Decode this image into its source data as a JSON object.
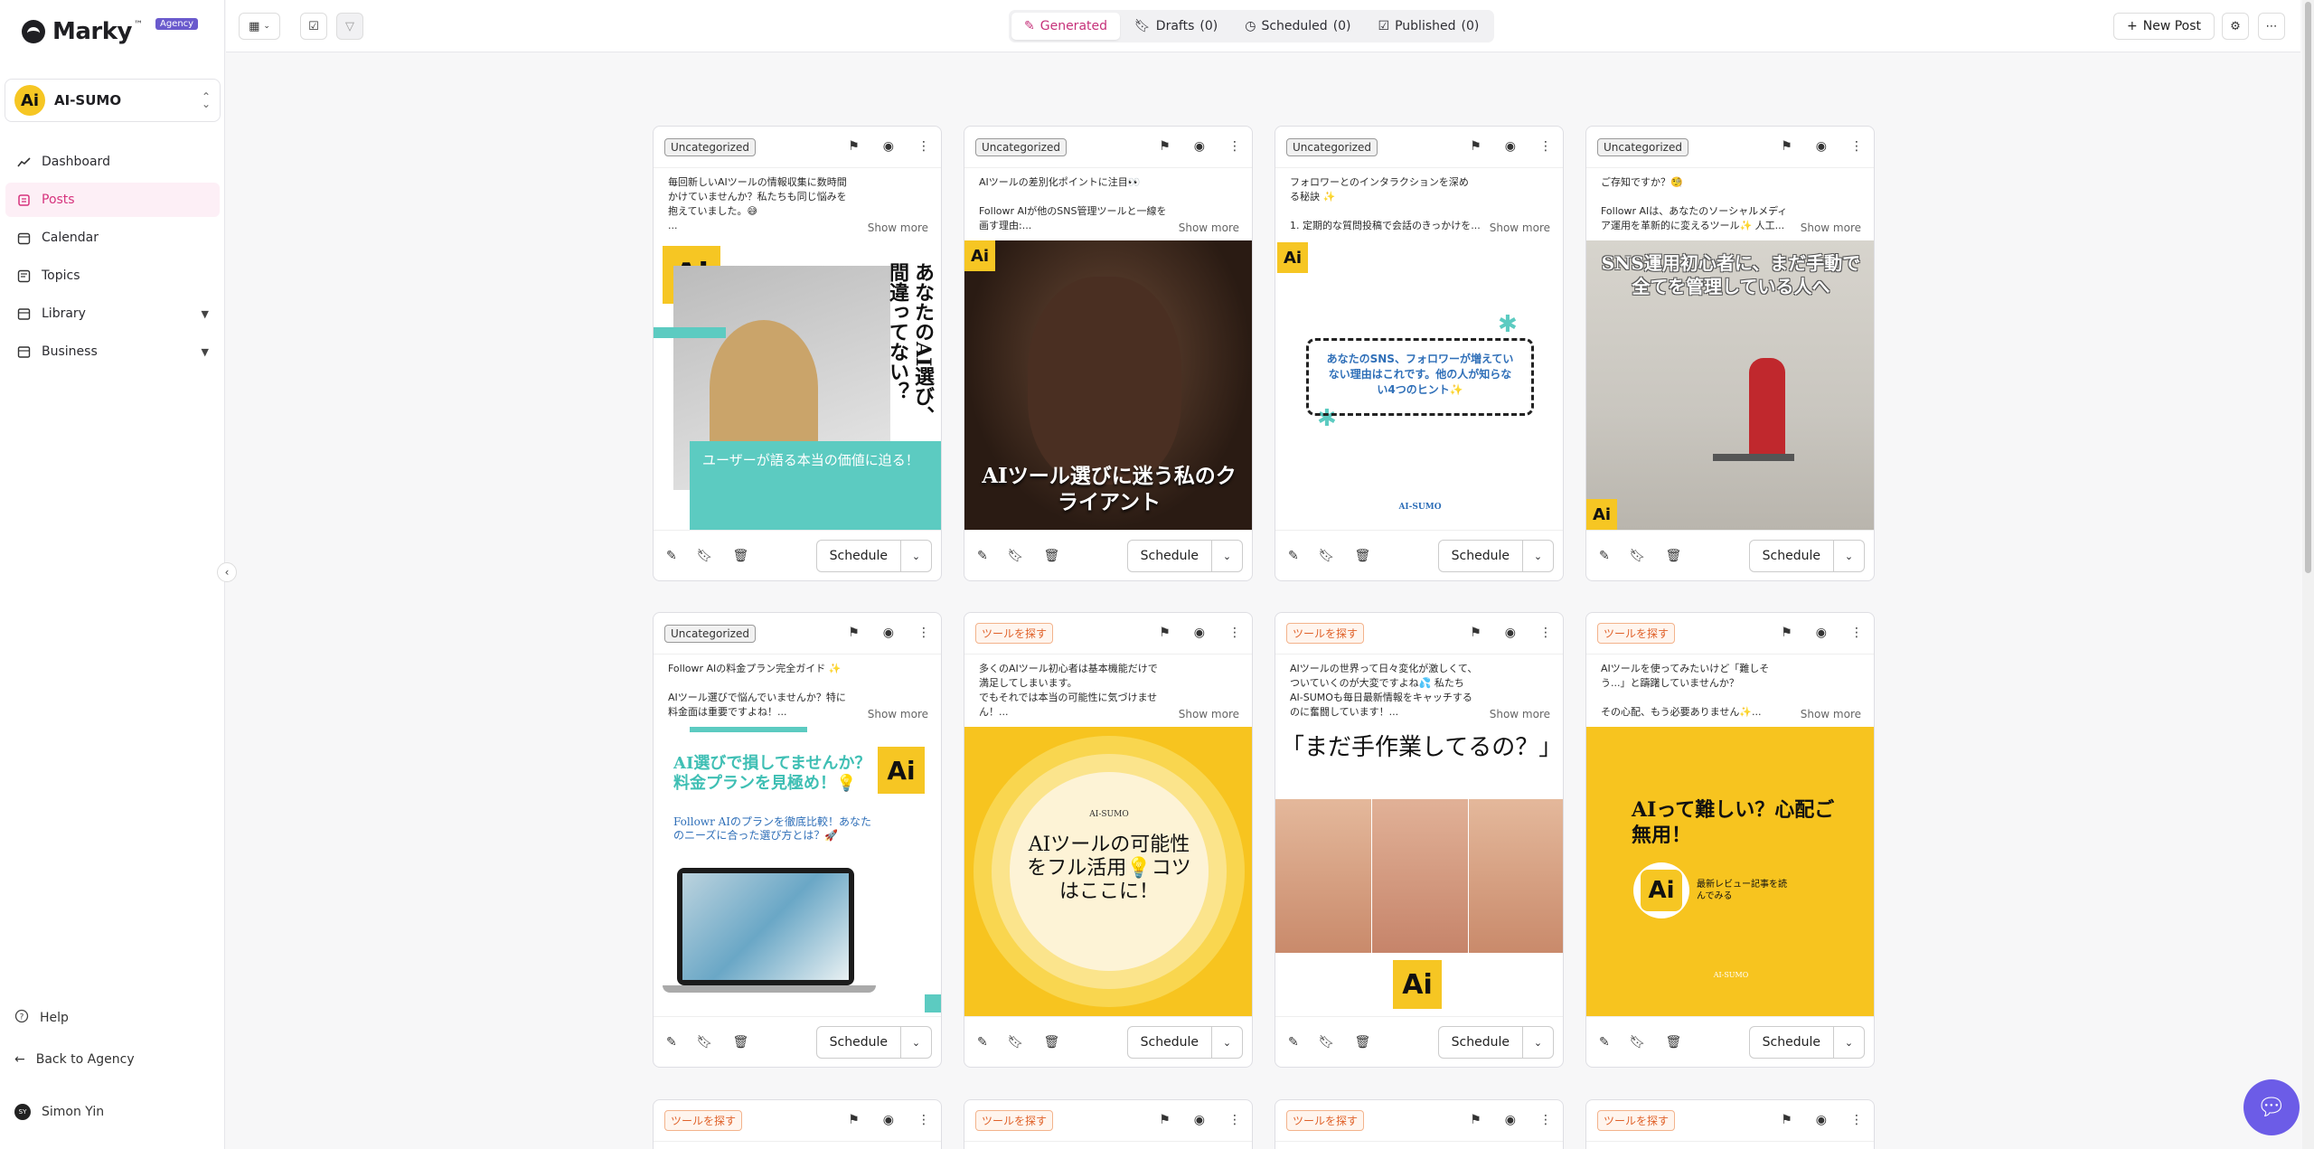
{
  "brand": {
    "name": "Marky",
    "tm": "™",
    "badge": "Agency"
  },
  "workspace": {
    "initials": "Ai",
    "name": "AI-SUMO"
  },
  "nav": [
    {
      "label": "Dashboard",
      "icon": "chart-line-icon"
    },
    {
      "label": "Posts",
      "icon": "posts-icon",
      "active": true
    },
    {
      "label": "Calendar",
      "icon": "calendar-icon"
    },
    {
      "label": "Topics",
      "icon": "topics-icon"
    },
    {
      "label": "Library",
      "icon": "library-icon",
      "expandable": true
    },
    {
      "label": "Business",
      "icon": "business-icon",
      "expandable": true
    }
  ],
  "bottom": {
    "help": "Help",
    "back": "Back to Agency",
    "user_initials": "SY",
    "user_name": "Simon Yin"
  },
  "tabs": [
    {
      "label": "Generated",
      "count": ""
    },
    {
      "label": "Drafts",
      "count": "(0)"
    },
    {
      "label": "Scheduled",
      "count": "(0)"
    },
    {
      "label": "Published",
      "count": "(0)"
    }
  ],
  "new_post": "New Post",
  "show_more": "Show more",
  "schedule": "Schedule",
  "cards": [
    {
      "tag": "Uncategorized",
      "lines": [
        "毎回新しいAIツールの情報収集に数時間",
        "かけていませんか？私たちも同じ悩みを",
        "抱えていました。😅",
        "..."
      ],
      "img": {
        "text": "ユーザーが語る本当の価値に迫る！",
        "vert": "あなたのAI選び、間違ってない？"
      }
    },
    {
      "tag": "Uncategorized",
      "lines": [
        "AIツールの差別化ポイントに注目👀",
        "",
        "Followr AIが他のSNS管理ツールと一線を",
        "画す理由:..."
      ],
      "img": {
        "text": "AIツール選びに迷う私のクライアント"
      }
    },
    {
      "tag": "Uncategorized",
      "lines": [
        "フォロワーとのインタラクションを深め",
        "る秘訣 ✨",
        "",
        "1. 定期的な質問投稿で会話のきっかけを..."
      ],
      "img": {
        "text": "あなたのSNS、フォロワーが増えていない理由はこれです。他の人が知らない4つのヒント✨",
        "brand": "AI-SUMO"
      }
    },
    {
      "tag": "Uncategorized",
      "lines": [
        "ご存知ですか？🧐",
        "",
        "Followr AIは、あなたのソーシャルメディ",
        "ア運用を革新的に変えるツール✨ 人工..."
      ],
      "img": {
        "text": "SNS運用初心者に、まだ手動で全てを管理している人へ"
      }
    },
    {
      "tag": "Uncategorized",
      "lines": [
        "Followr AIの料金プラン完全ガイド ✨",
        "",
        "AIツール選びで悩んでいませんか？特に",
        "料金面は重要ですよね！..."
      ],
      "img": {
        "title": "AI選びで損してませんか？料金プランを見極め！💡",
        "sub": "Followr AIのプランを徹底比較！あなたのニーズに合った選び方とは？🚀"
      }
    },
    {
      "tag": "ツールを探す",
      "lines": [
        "多くのAIツール初心者は基本機能だけで",
        "満足してしまいます。",
        "でもそれでは本当の可能性に気づけませ",
        "ん！..."
      ],
      "img": {
        "text": "AIツールの可能性をフル活用💡コツはここに！",
        "brand": "AI-SUMO"
      }
    },
    {
      "tag": "ツールを探す",
      "lines": [
        "AIツールの世界って日々変化が激しくて、",
        "ついていくのが大変ですよね💦 私たち",
        "AI-SUMOも毎日最新情報をキャッチする",
        "のに奮闘しています！..."
      ],
      "img": {
        "text": "「まだ手作業してるの？」"
      }
    },
    {
      "tag": "ツールを探す",
      "lines": [
        "AIツールを使ってみたいけど「難しそ",
        "う...」と躊躇していませんか？",
        "",
        "その心配、もう必要ありません✨..."
      ],
      "img": {
        "text": "AIって難しい？心配ご無用！",
        "sub": "最新レビュー記事を読んでみる",
        "brand": "AI-SUMO"
      }
    },
    {
      "tag": "ツールを探す"
    },
    {
      "tag": "ツールを探す"
    },
    {
      "tag": "ツールを探す"
    },
    {
      "tag": "ツールを探す"
    }
  ]
}
